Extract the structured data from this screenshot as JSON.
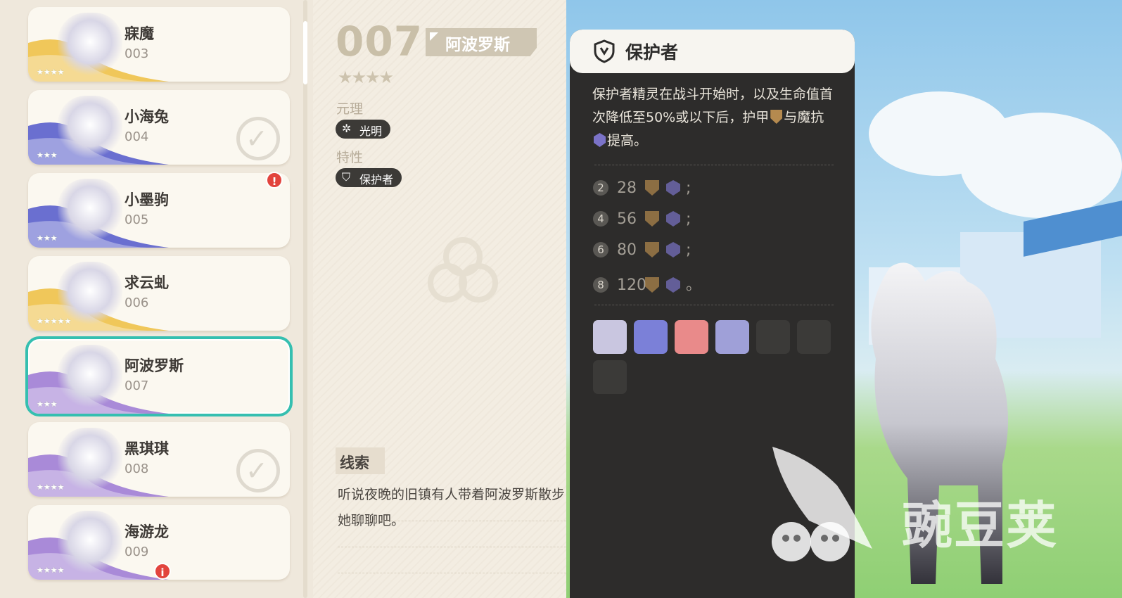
{
  "list": {
    "items": [
      {
        "name": "寐魔",
        "num": "003",
        "stars": "★★★★",
        "color": "#f0c75a",
        "check": false
      },
      {
        "name": "小海兔",
        "num": "004",
        "stars": "★★★",
        "color": "#6a6fd0",
        "check": true
      },
      {
        "name": "小墨驹",
        "num": "005",
        "stars": "★★★",
        "color": "#6a6fd0",
        "check": false,
        "badge": "!"
      },
      {
        "name": "求云虬",
        "num": "006",
        "stars": "★★★★★",
        "color": "#f0c75a",
        "check": false
      },
      {
        "name": "阿波罗斯",
        "num": "007",
        "stars": "★★★",
        "color": "#a98ad8",
        "check": false,
        "selected": true
      },
      {
        "name": "黑琪琪",
        "num": "008",
        "stars": "★★★★",
        "color": "#a98ad8",
        "check": true
      },
      {
        "name": "海游龙",
        "num": "009",
        "stars": "★★★★",
        "color": "#a98ad8",
        "check": false,
        "badge": "i"
      }
    ]
  },
  "detail": {
    "number": "007",
    "name": "阿波罗斯",
    "stars": "★★★★",
    "element_label": "元理",
    "element_value": "光明",
    "trait_label": "特性",
    "trait_value": "保护者",
    "clue_title": "线索",
    "clue_text": "听说夜晚的旧镇有人带着阿波罗斯散步，去找她聊聊吧。"
  },
  "tooltip": {
    "title": "保护者",
    "desc_part1": "保护者精灵在战斗开始时，以及生命值首次降低至50%或以下后，护甲",
    "desc_part2": "与魔抗",
    "desc_part3": "提高。",
    "tiers": [
      {
        "count": "2",
        "value": "28",
        "end": ";"
      },
      {
        "count": "4",
        "value": "56",
        "end": ";"
      },
      {
        "count": "6",
        "value": "80",
        "end": ";"
      },
      {
        "count": "8",
        "value": "120",
        "end": "。"
      }
    ],
    "members": [
      "#c9c6e0",
      "#7b80d8",
      "#e98a8a",
      "#9fa0d8",
      "#3b3a38",
      "#3b3a38",
      "#3b3a38"
    ]
  },
  "watermark": "豌豆荚",
  "colors": {
    "accent": "#35bfb0",
    "badge": "#e2443d",
    "armor": "#b58a4f",
    "magic_resist": "#7b73c8"
  }
}
